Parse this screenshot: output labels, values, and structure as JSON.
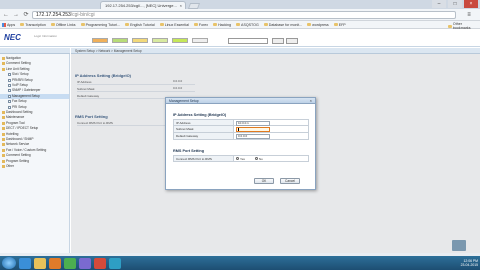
{
  "browser": {
    "tab_title": "192.17.254.253/cgi/..., [NEC] Univerge...",
    "tab_close": "×",
    "nav": {
      "back": "←",
      "forward": "→",
      "reload": "⟳"
    },
    "url_host": "172.17.254.253",
    "url_path": "/cgi-bin/cgi",
    "menu_glyph": "≡",
    "window_buttons": [
      "–",
      "□",
      "×"
    ],
    "bookmarks": [
      "Apps",
      "Transcription",
      "Offline Links",
      "Programming Tutori...",
      "English Tutorial",
      "Linux Essential",
      "Forex",
      "Hacking",
      "ASQSTOG",
      "Database for monit...",
      "wordpress",
      "EFP"
    ],
    "other_bookmarks": "Other bookmarks"
  },
  "app": {
    "logo": "NEC",
    "logo_sub": "Logic Information",
    "mode_buttons": [
      {
        "color": "#f0b05a"
      },
      {
        "color": "#b8dc78"
      },
      {
        "color": "#f2d97a"
      },
      {
        "color": "#d8eaa0"
      },
      {
        "color": "#c6e858"
      },
      {
        "color": "#eeeeee"
      }
    ]
  },
  "sidebar": {
    "items": [
      {
        "label": "Navigation",
        "icon": "folder"
      },
      {
        "label": "Comment Setting",
        "icon": "folder"
      },
      {
        "label": "Line Unit Setting",
        "icon": "folder"
      },
      {
        "label": "Slot / Setup",
        "icon": "page"
      },
      {
        "label": "PRI/BRI Setup",
        "icon": "page"
      },
      {
        "label": "VoIP Setup",
        "icon": "page"
      },
      {
        "label": "SNMP / Gatekeeper",
        "icon": "page"
      },
      {
        "label": "Management Setup",
        "icon": "page",
        "selected": true
      },
      {
        "label": "Fax Setup",
        "icon": "page"
      },
      {
        "label": "PRI Setup",
        "icon": "page"
      },
      {
        "label": "Dashboard Setting",
        "icon": "folder"
      },
      {
        "label": "Maintenance",
        "icon": "folder"
      },
      {
        "label": "Program Tool",
        "icon": "folder"
      },
      {
        "label": "DECT / IPDECT Setup",
        "icon": "folder"
      },
      {
        "label": "Hotelling",
        "icon": "folder"
      },
      {
        "label": "Dashboard / SNMP",
        "icon": "folder"
      },
      {
        "label": "Network Service",
        "icon": "folder"
      },
      {
        "label": "Fax / Voice / Custom Setting",
        "icon": "folder"
      },
      {
        "label": "Comment Setting",
        "icon": "folder"
      },
      {
        "label": "Program Setting",
        "icon": "folder"
      },
      {
        "label": "Other",
        "icon": "folder"
      }
    ]
  },
  "main": {
    "breadcrumb": "System Setup > Network > Management Setup",
    "ip_section": "IP Address Setting (BridgeIO)",
    "ip_rows": [
      {
        "label": "IP Address",
        "value": "0.0.0.0"
      },
      {
        "label": "Subnet Mask",
        "value": "0.0.0.0"
      },
      {
        "label": "Default Gateway",
        "value": ""
      }
    ],
    "rms_section": "RMS Port Setting",
    "rms_row": {
      "label": "Connect RMS Port to RMS",
      "value": ""
    }
  },
  "modal": {
    "title": "Management Setup",
    "close": "×",
    "ip_section": "IP Address Setting (BridgeIO)",
    "rows": [
      {
        "label": "IP Address",
        "value": "10.0.0.1",
        "active": false
      },
      {
        "label": "Subnet Mask",
        "value": "",
        "active": true
      },
      {
        "label": "Default Gateway",
        "value": "0.0.0.0",
        "active": false
      }
    ],
    "rms_section": "RMS Port Setting",
    "rms_label": "Connect RMS Port to RMS",
    "radio_yes": "Yes",
    "radio_no": "No",
    "radio_selected": "yes",
    "ok_label": "OK",
    "cancel_label": "Cancel"
  },
  "taskbar": {
    "icons": [
      {
        "name": "ie",
        "color": "#3a8fd8"
      },
      {
        "name": "explorer",
        "color": "#e8c15a"
      },
      {
        "name": "media",
        "color": "#e07b2a"
      },
      {
        "name": "chrome",
        "color": "#4caf50"
      },
      {
        "name": "app5",
        "color": "#7a6ad0"
      },
      {
        "name": "app6",
        "color": "#d44a3a"
      },
      {
        "name": "app7",
        "color": "#2e9ec4"
      }
    ],
    "time": "12:06 PM",
    "date": "23-04-2015"
  }
}
